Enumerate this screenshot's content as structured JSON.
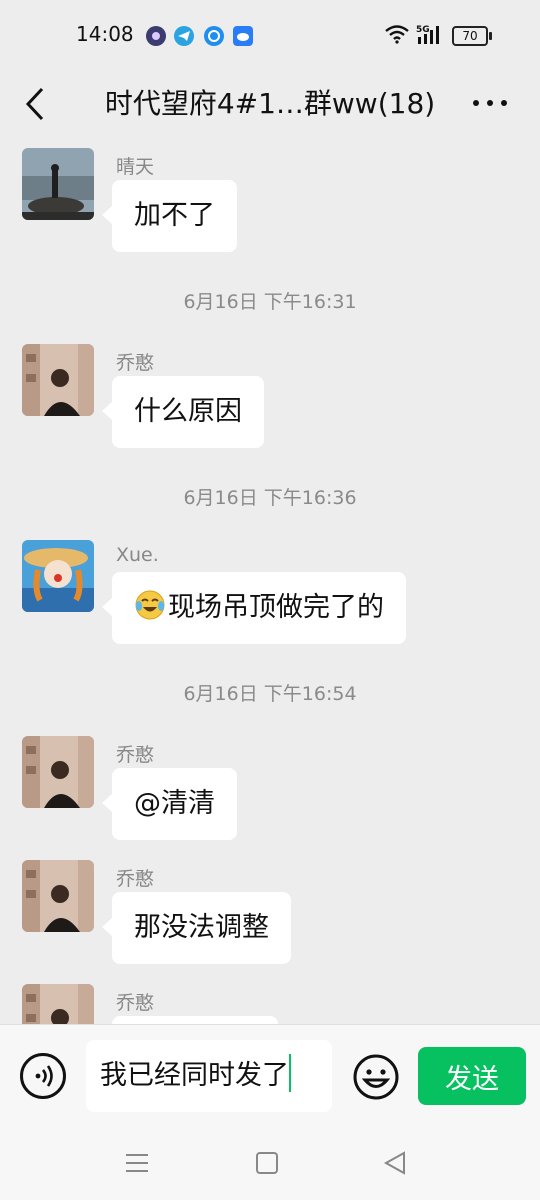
{
  "status_bar": {
    "time": "14:08",
    "network": "5G",
    "battery": "70",
    "notification_icons": [
      "podcast-icon",
      "telegram-icon",
      "qq-icon",
      "cloud-icon"
    ]
  },
  "header": {
    "title": "时代望府4#1…群ww(18)",
    "back_icon": "chevron-left-icon",
    "more_icon": "more-dots-icon"
  },
  "messages": [
    {
      "type": "message",
      "sender": "晴天",
      "text": "加不了"
    },
    {
      "type": "timestamp",
      "text": "6月16日 下午16:31"
    },
    {
      "type": "message",
      "sender": "乔憨",
      "text": "什么原因"
    },
    {
      "type": "timestamp",
      "text": "6月16日 下午16:36"
    },
    {
      "type": "message",
      "sender": "Xue.",
      "text": "现场吊顶做完了的",
      "emoji": "crying-laughing-emoji"
    },
    {
      "type": "timestamp",
      "text": "6月16日 下午16:54"
    },
    {
      "type": "message",
      "sender": "乔憨",
      "text": "@清清"
    },
    {
      "type": "message",
      "sender": "乔憨",
      "text": "那没法调整"
    },
    {
      "type": "message",
      "sender": "乔憨",
      "text": ""
    }
  ],
  "input_bar": {
    "value": "我已经同时发了",
    "send_label": "发送"
  },
  "colors": {
    "accent": "#07c160",
    "background": "#ededed",
    "bubble": "#ffffff"
  }
}
